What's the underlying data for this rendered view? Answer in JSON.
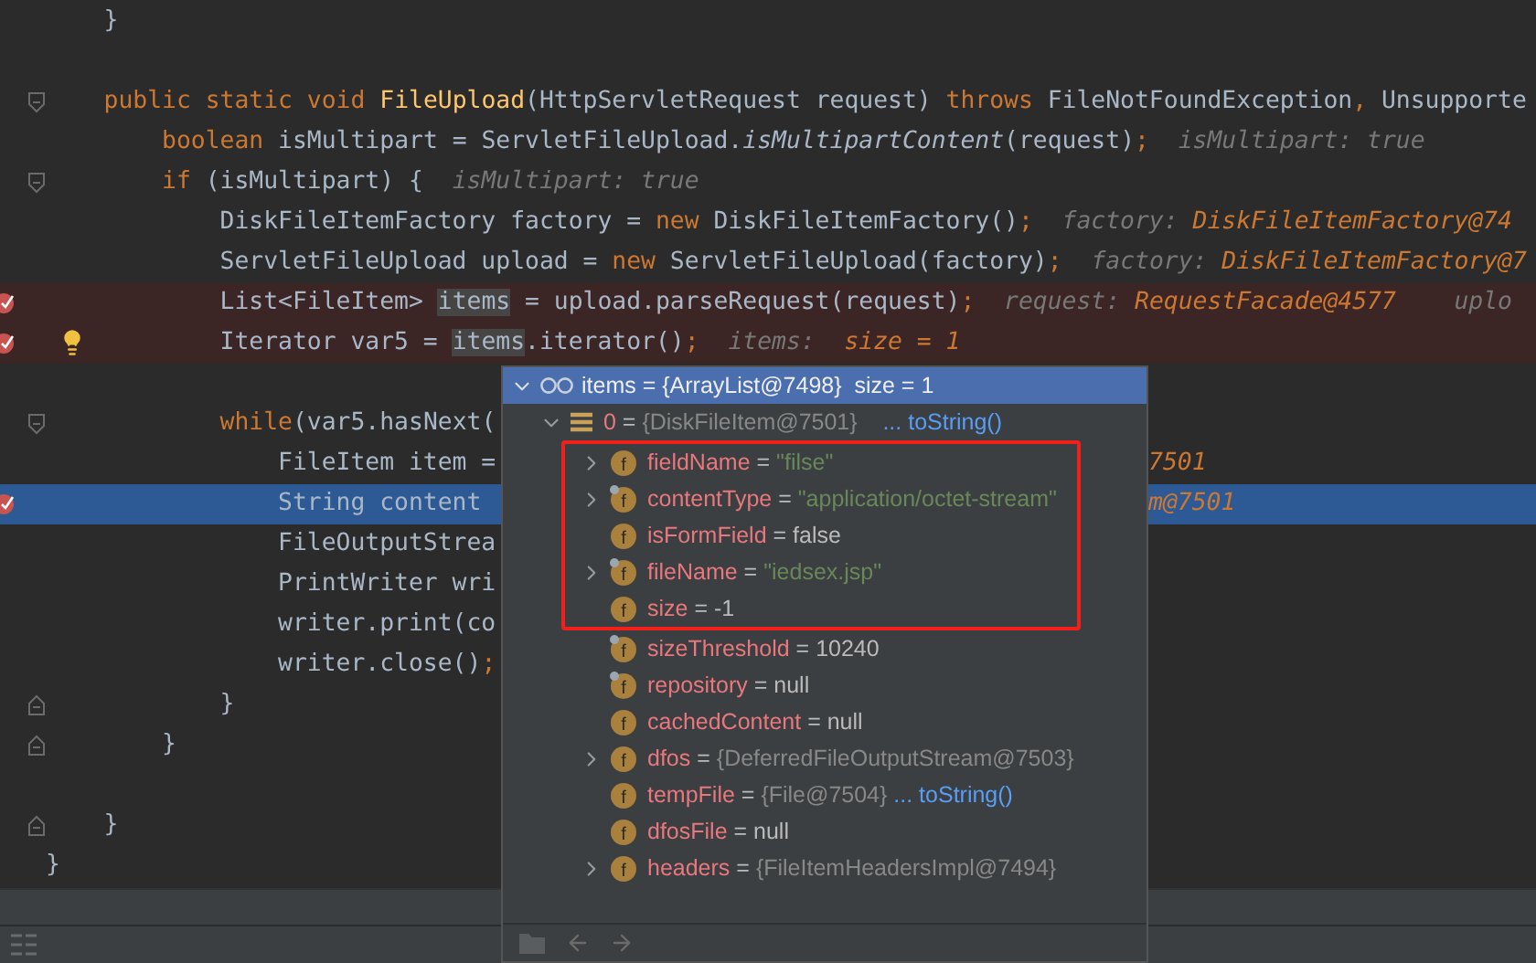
{
  "editor": {
    "lines": [
      {
        "kind": "full",
        "fold_open": false,
        "fold_close": false,
        "breakpoint": false,
        "current": false,
        "tokens": [
          {
            "kind": "plain",
            "text": "    }"
          }
        ]
      },
      {
        "kind": "full",
        "fold_open": false,
        "fold_close": false,
        "breakpoint": false,
        "current": false
      },
      {
        "kind": "full",
        "fold_open": true,
        "fold_close": false,
        "breakpoint": false,
        "current": false,
        "tokens": [
          {
            "kind": "kw",
            "text": "    public static void "
          },
          {
            "kind": "fn",
            "text": "FileUpload"
          },
          {
            "kind": "plain",
            "text": "(HttpServletRequest request) "
          },
          {
            "kind": "kw",
            "text": "throws "
          },
          {
            "kind": "plain",
            "text": "FileNotFoundException"
          },
          {
            "kind": "kw",
            "text": ", "
          },
          {
            "kind": "plain",
            "text": "Unsupporte"
          }
        ]
      },
      {
        "kind": "full",
        "fold_open": false,
        "fold_close": false,
        "breakpoint": false,
        "current": false,
        "tokens": [
          {
            "kind": "kw",
            "text": "        boolean "
          },
          {
            "kind": "plain",
            "text": "isMultipart = ServletFileUpload."
          },
          {
            "kind": "static",
            "text": "isMultipartContent"
          },
          {
            "kind": "plain",
            "text": "(request)"
          },
          {
            "kind": "kw",
            "text": ";  "
          },
          {
            "kind": "hint",
            "text": "isMultipart: true"
          }
        ]
      },
      {
        "kind": "full",
        "fold_open": true,
        "fold_close": false,
        "breakpoint": false,
        "current": false,
        "tokens": [
          {
            "kind": "kw",
            "text": "        if "
          },
          {
            "kind": "plain",
            "text": "(isMultipart) {  "
          },
          {
            "kind": "hint",
            "text": "isMultipart: true"
          }
        ]
      },
      {
        "kind": "full",
        "fold_open": false,
        "fold_close": false,
        "breakpoint": false,
        "current": false,
        "tokens": [
          {
            "kind": "plain",
            "text": "            DiskFileItemFactory factory = "
          },
          {
            "kind": "kw",
            "text": "new "
          },
          {
            "kind": "plain",
            "text": "DiskFileItemFactory()"
          },
          {
            "kind": "kw",
            "text": ";  "
          },
          {
            "kind": "hint",
            "text": "factory: "
          },
          {
            "kind": "hintval",
            "text": "DiskFileItemFactory@74"
          }
        ]
      },
      {
        "kind": "full",
        "fold_open": false,
        "fold_close": false,
        "breakpoint": false,
        "current": false,
        "tokens": [
          {
            "kind": "plain",
            "text": "            ServletFileUpload upload = "
          },
          {
            "kind": "kw",
            "text": "new "
          },
          {
            "kind": "plain",
            "text": "ServletFileUpload(factory)"
          },
          {
            "kind": "kw",
            "text": ";  "
          },
          {
            "kind": "hint",
            "text": "factory: "
          },
          {
            "kind": "hintval",
            "text": "DiskFileItemFactory@7"
          }
        ]
      },
      {
        "kind": "full",
        "fold_open": false,
        "fold_close": false,
        "breakpoint": true,
        "current": false,
        "tokens": [
          {
            "kind": "plain",
            "text": "            List<FileItem> "
          },
          {
            "kind": "usage",
            "text": "items"
          },
          {
            "kind": "plain",
            "text": " = upload.parseRequest(request)"
          },
          {
            "kind": "kw",
            "text": ";  "
          },
          {
            "kind": "hint",
            "text": "request: "
          },
          {
            "kind": "hintval",
            "text": "RequestFacade@4577"
          },
          {
            "kind": "hint",
            "text": "    uplo"
          }
        ]
      },
      {
        "kind": "full",
        "fold_open": false,
        "fold_close": false,
        "breakpoint": true,
        "current": false,
        "bulb": true,
        "tokens": [
          {
            "kind": "plain",
            "text": "            Iterator var5 = "
          },
          {
            "kind": "usage",
            "text": "items"
          },
          {
            "kind": "plain",
            "text": ".iterator()"
          },
          {
            "kind": "kw",
            "text": ";  "
          },
          {
            "kind": "hint",
            "text": "items:  "
          },
          {
            "kind": "hintval",
            "text": "size = 1"
          }
        ]
      },
      {
        "kind": "full",
        "fold_open": false,
        "fold_close": false,
        "breakpoint": false,
        "current": false
      },
      {
        "kind": "split",
        "fold_open": true,
        "fold_close": false,
        "breakpoint": false,
        "current": false,
        "tokens": [
          {
            "kind": "kw",
            "text": "            while"
          },
          {
            "kind": "plain",
            "text": "(var5.hasNext("
          }
        ]
      },
      {
        "kind": "split",
        "fold_open": false,
        "fold_close": false,
        "breakpoint": false,
        "current": false,
        "tokens": [
          {
            "kind": "plain",
            "text": "                FileItem item = "
          }
        ],
        "right": [
          {
            "kind": "hintval",
            "text": "7501"
          }
        ]
      },
      {
        "kind": "split",
        "fold_open": false,
        "fold_close": false,
        "breakpoint": true,
        "current": true,
        "tokens": [
          {
            "kind": "plain",
            "text": "                String content "
          }
        ],
        "right": [
          {
            "kind": "hintval",
            "text": "m@7501"
          }
        ]
      },
      {
        "kind": "split",
        "fold_open": false,
        "fold_close": false,
        "breakpoint": false,
        "current": false,
        "tokens": [
          {
            "kind": "plain",
            "text": "                FileOutputStrea"
          }
        ]
      },
      {
        "kind": "split",
        "fold_open": false,
        "fold_close": false,
        "breakpoint": false,
        "current": false,
        "tokens": [
          {
            "kind": "plain",
            "text": "                PrintWriter wri"
          }
        ]
      },
      {
        "kind": "split",
        "fold_open": false,
        "fold_close": false,
        "breakpoint": false,
        "current": false,
        "tokens": [
          {
            "kind": "plain",
            "text": "                writer.print(co"
          }
        ]
      },
      {
        "kind": "split",
        "fold_open": false,
        "fold_close": false,
        "breakpoint": false,
        "current": false,
        "tokens": [
          {
            "kind": "plain",
            "text": "                writer.close()"
          },
          {
            "kind": "kw",
            "text": ";"
          }
        ]
      },
      {
        "kind": "split",
        "fold_open": false,
        "fold_close": true,
        "breakpoint": false,
        "current": false,
        "tokens": [
          {
            "kind": "plain",
            "text": "            }"
          }
        ]
      },
      {
        "kind": "split",
        "fold_open": false,
        "fold_close": true,
        "breakpoint": false,
        "current": false,
        "tokens": [
          {
            "kind": "plain",
            "text": "        }"
          }
        ]
      },
      {
        "kind": "split",
        "fold_open": false,
        "fold_close": false,
        "breakpoint": false,
        "current": false
      },
      {
        "kind": "split",
        "fold_open": false,
        "fold_close": true,
        "breakpoint": false,
        "current": false,
        "tokens": [
          {
            "kind": "plain",
            "text": "    }"
          }
        ]
      },
      {
        "kind": "split",
        "fold_open": false,
        "fold_close": false,
        "breakpoint": false,
        "current": false,
        "tokens": [
          {
            "kind": "plain",
            "text": "}"
          }
        ]
      }
    ]
  },
  "popup": {
    "root": {
      "name": "items",
      "operator": "=",
      "value": "{ArrayList@7498}",
      "extra": "size = 1",
      "expanded": true
    },
    "item": {
      "name": "0",
      "operator": "=",
      "value": "{DiskFileItem@7501}",
      "link": "... toString()",
      "expanded": true
    },
    "fields": [
      {
        "icon_letter": "f",
        "name": "fieldName",
        "operator": "=",
        "value": "\"filse\"",
        "kind": "string",
        "expandable": true,
        "final": false,
        "highlighted": true
      },
      {
        "icon_letter": "f",
        "name": "contentType",
        "operator": "=",
        "value": "\"application/octet-stream\"",
        "kind": "string",
        "expandable": true,
        "final": true,
        "highlighted": true
      },
      {
        "icon_letter": "f",
        "name": "isFormField",
        "operator": "=",
        "value": "false",
        "kind": "plain",
        "expandable": false,
        "final": false,
        "highlighted": true
      },
      {
        "icon_letter": "f",
        "name": "fileName",
        "operator": "=",
        "value": "\"iedsex.jsp\"",
        "kind": "string",
        "expandable": true,
        "final": true,
        "highlighted": true
      },
      {
        "icon_letter": "f",
        "name": "size",
        "operator": "=",
        "value": "-1",
        "kind": "plain",
        "expandable": false,
        "final": false,
        "highlighted": true
      },
      {
        "icon_letter": "f",
        "name": "sizeThreshold",
        "operator": "=",
        "value": "10240",
        "kind": "plain",
        "expandable": false,
        "final": true,
        "highlighted": false
      },
      {
        "icon_letter": "f",
        "name": "repository",
        "operator": "=",
        "value": "null",
        "kind": "plain",
        "expandable": false,
        "final": true,
        "highlighted": false
      },
      {
        "icon_letter": "f",
        "name": "cachedContent",
        "operator": "=",
        "value": "null",
        "kind": "plain",
        "expandable": false,
        "final": false,
        "highlighted": false
      },
      {
        "icon_letter": "f",
        "name": "dfos",
        "operator": "=",
        "value": "{DeferredFileOutputStream@7503}",
        "kind": "object",
        "expandable": true,
        "final": false,
        "highlighted": false
      },
      {
        "icon_letter": "f",
        "name": "tempFile",
        "operator": "=",
        "value": "{File@7504}",
        "link": "... toString()",
        "kind": "object",
        "expandable": false,
        "final": false,
        "highlighted": false
      },
      {
        "icon_letter": "f",
        "name": "dfosFile",
        "operator": "=",
        "value": "null",
        "kind": "plain",
        "expandable": false,
        "final": false,
        "highlighted": false
      },
      {
        "icon_letter": "f",
        "name": "headers",
        "operator": "=",
        "value": "{FileItemHeadersImpl@7494}",
        "kind": "object",
        "expandable": true,
        "final": false,
        "highlighted": false
      }
    ]
  }
}
